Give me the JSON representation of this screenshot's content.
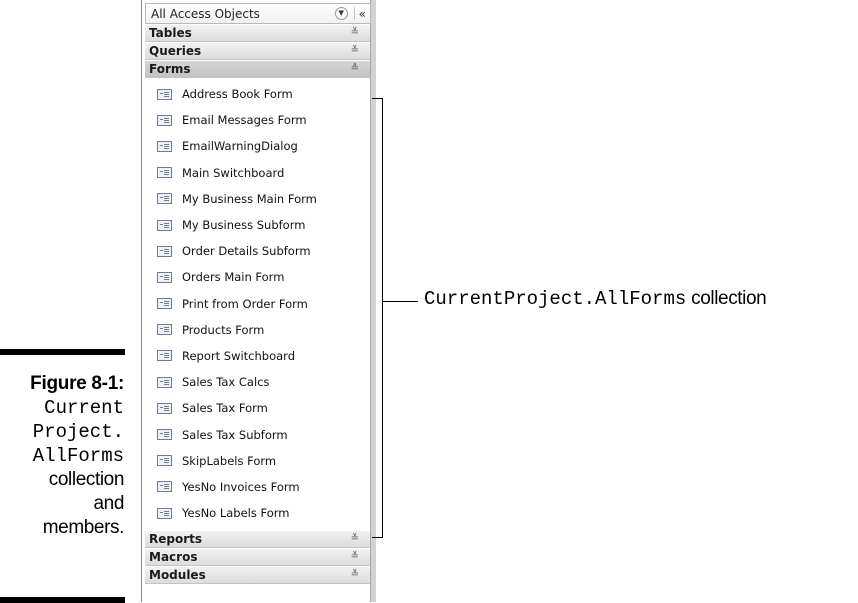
{
  "caption": {
    "label": "Figure 8-1:",
    "code_line1": "Current",
    "code_line2": "Project.",
    "code_line3": "AllForms",
    "text_line1": "collection",
    "text_line2": "and",
    "text_line3": "members."
  },
  "nav": {
    "title": "All Access Objects",
    "dropdown_glyph": "▼",
    "collapse_glyph": "«",
    "groups_top": [
      {
        "label": "Tables",
        "chevron": "≚"
      },
      {
        "label": "Queries",
        "chevron": "≚"
      }
    ],
    "forms_group": {
      "label": "Forms",
      "chevron": "≙"
    },
    "forms": [
      "Address Book Form",
      "Email Messages Form",
      "EmailWarningDialog",
      "Main Switchboard",
      "My Business Main Form",
      "My Business Subform",
      "Order Details Subform",
      "Orders Main Form",
      "Print from Order Form",
      "Products Form",
      "Report Switchboard",
      "Sales Tax Calcs",
      "Sales Tax Form",
      "Sales Tax Subform",
      "SkipLabels Form",
      "YesNo Invoices Form",
      "YesNo Labels Form"
    ],
    "groups_bottom": [
      {
        "label": "Reports",
        "chevron": "≚"
      },
      {
        "label": "Macros",
        "chevron": "≚"
      },
      {
        "label": "Modules",
        "chevron": "≚"
      }
    ]
  },
  "callout": {
    "code": "CurrentProject.AllForms",
    "text": " collection"
  }
}
